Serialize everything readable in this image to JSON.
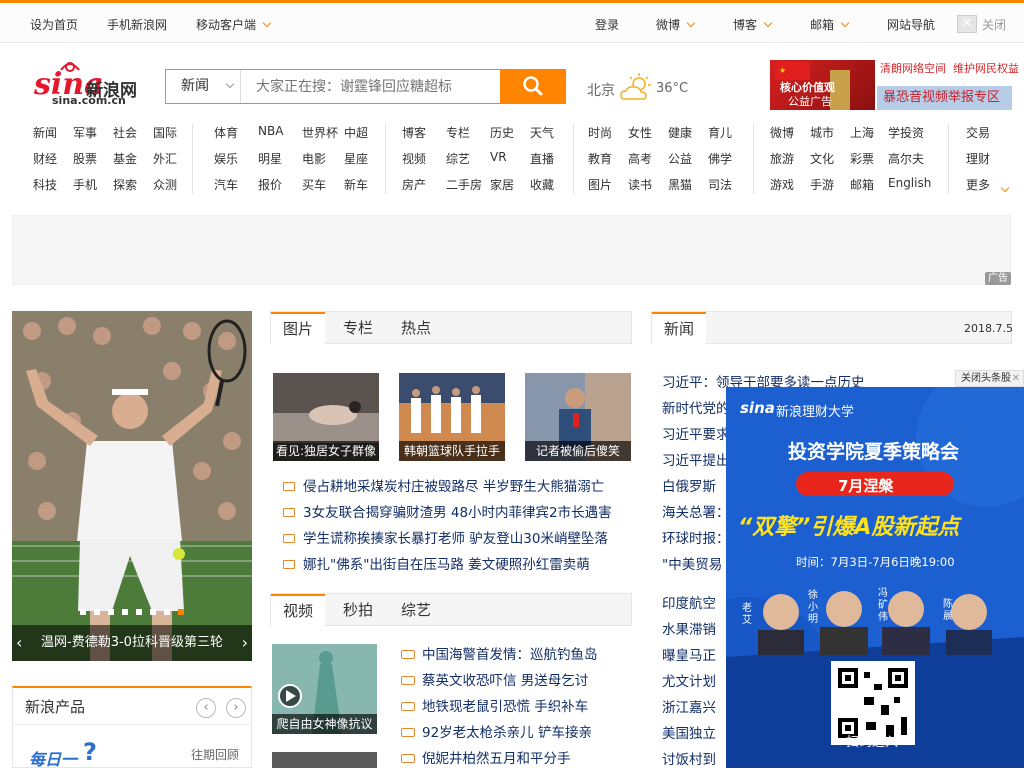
{
  "topbar": {
    "home": "设为首页",
    "mobile": "手机新浪网",
    "client": "移动客户端",
    "login": "登录",
    "weibo": "微博",
    "blog": "博客",
    "mail": "邮箱",
    "sitenav": "网站导航",
    "close": "关闭"
  },
  "logo": {
    "text": "新浪网",
    "domain": "sina.com.cn"
  },
  "search": {
    "category": "新闻",
    "placeholder": "大家正在搜：谢霆锋回应糖超标"
  },
  "weather": {
    "city": "北京",
    "temp": "36°C"
  },
  "right_ads": {
    "banner1_line1": "核心价值观",
    "banner1_line2": "公益广告",
    "link1a": "清朗网络空间",
    "link1b": "维护网民权益",
    "link2": "暴恐音视频举报专区"
  },
  "nav": {
    "g1": [
      [
        "新闻",
        "军事",
        "社会",
        "国际"
      ],
      [
        "财经",
        "股票",
        "基金",
        "外汇"
      ],
      [
        "科技",
        "手机",
        "探索",
        "众测"
      ]
    ],
    "g2": [
      [
        "体育",
        "NBA",
        "世界杯",
        "中超"
      ],
      [
        "娱乐",
        "明星",
        "电影",
        "星座"
      ],
      [
        "汽车",
        "报价",
        "买车",
        "新车"
      ]
    ],
    "g3": [
      [
        "博客",
        "专栏",
        "历史",
        "天气"
      ],
      [
        "视频",
        "综艺",
        "VR",
        "直播"
      ],
      [
        "房产",
        "二手房",
        "家居",
        "收藏"
      ]
    ],
    "g4": [
      [
        "时尚",
        "女性",
        "健康",
        "育儿"
      ],
      [
        "教育",
        "高考",
        "公益",
        "佛学"
      ],
      [
        "图片",
        "读书",
        "黑猫",
        "司法"
      ]
    ],
    "g5": [
      [
        "微博",
        "城市",
        "上海",
        "学投资"
      ],
      [
        "旅游",
        "文化",
        "彩票",
        "高尔夫"
      ],
      [
        "游戏",
        "手游",
        "邮箱",
        "English"
      ]
    ],
    "g6": [
      "交易",
      "理财",
      "更多"
    ]
  },
  "ad_label": "广告",
  "photo": {
    "caption": "温网-费德勒3-0拉科晋级第三轮"
  },
  "pic_tabs": [
    "图片",
    "专栏",
    "热点"
  ],
  "thumbs": [
    "看见:独居女子群像",
    "韩朝篮球队手拉手",
    "记者被偷后傻笑"
  ],
  "pic_headlines": [
    "侵占耕地采煤炭村庄被毁路尽 半岁野生大熊猫溺亡",
    "3女友联合揭穿骗财渣男 48小时内菲律宾2市长遇害",
    "学生谎称挨揍家长暴打老师 驴友登山30米峭壁坠落",
    "娜扎\"佛系\"出街自在压马路 姜文硬照孙红雷卖萌"
  ],
  "video_tabs": [
    "视频",
    "秒拍",
    "综艺"
  ],
  "video_thumb_caption": "爬自由女神像抗议",
  "video_headlines": [
    "中国海警首发情：巡航钓鱼岛",
    "蔡英文收恐吓信 男送母乞讨",
    "地铁现老鼠引恐慌 手织补车",
    "92岁老太枪杀亲儿 铲车接亲",
    "倪妮井柏然五月和平分手"
  ],
  "products": {
    "title": "新浪产品",
    "daily": "每日一",
    "review": "往期回顾"
  },
  "news": {
    "tab": "新闻",
    "date": "2018.7.5",
    "items": [
      "习近平：领导干部要多读一点历史",
      "新时代党的",
      "习近平要求",
      "习近平提出",
      "白俄罗斯",
      "海关总署：",
      "环球时报：",
      "\"中美贸易"
    ],
    "items2": [
      "印度航空",
      "水果滞销",
      "曝皇马正",
      "尤文计划",
      "浙江嘉兴",
      "美国独立",
      "讨饭村到"
    ]
  },
  "overlay": {
    "close": "关闭头条股",
    "brand": "新浪理财大学",
    "title": "投资学院夏季策略会",
    "badge": "7月涅槃",
    "slogan": "“双擎”引爆A股新起点",
    "time": "时间：7月3日-7月6日晚19:00",
    "names": [
      "老艾",
      "徐小明",
      "冯矿伟",
      "陈晨"
    ],
    "qr": "扫码进入"
  },
  "colors": {
    "accent": "#ff8400",
    "link": "#122e67",
    "overlay_blue": "#1b5fd0"
  }
}
